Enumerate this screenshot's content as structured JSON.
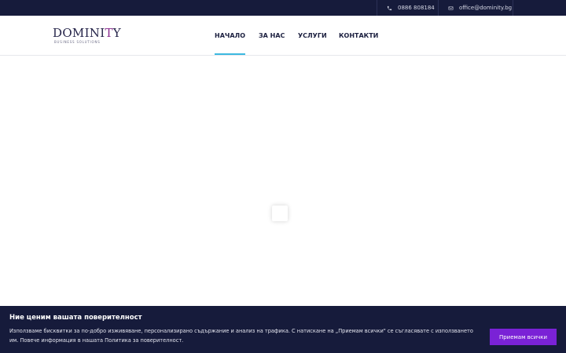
{
  "topbar": {
    "phone": "0886 808184",
    "email": "office@dominity.bg"
  },
  "logo": {
    "word_main": "DOMINI",
    "word_accent": "T",
    "word_end": "Y",
    "tagline": "BUSINESS SOLUTIONS"
  },
  "nav": {
    "items": [
      {
        "label": "НАЧАЛО",
        "active": true
      },
      {
        "label": "ЗА НАС",
        "active": false
      },
      {
        "label": "УСЛУГИ",
        "active": false
      },
      {
        "label": "КОНТАКТИ",
        "active": false
      }
    ]
  },
  "cookie": {
    "title": "Ние ценим вашата поверителност",
    "text": "Използваме бисквитки за по-добро изживяване, персонализирано съдържание и анализ на трафика. С натискане на „Приемам всички\" се съгласявате с използването им. Повече информация в нашата Политика за поверителност.",
    "accept_label": "Приемам всички"
  },
  "colors": {
    "dark_navy": "#161b3b",
    "accent_blue": "#3cb9e0",
    "button_purple": "#7a22d6"
  }
}
